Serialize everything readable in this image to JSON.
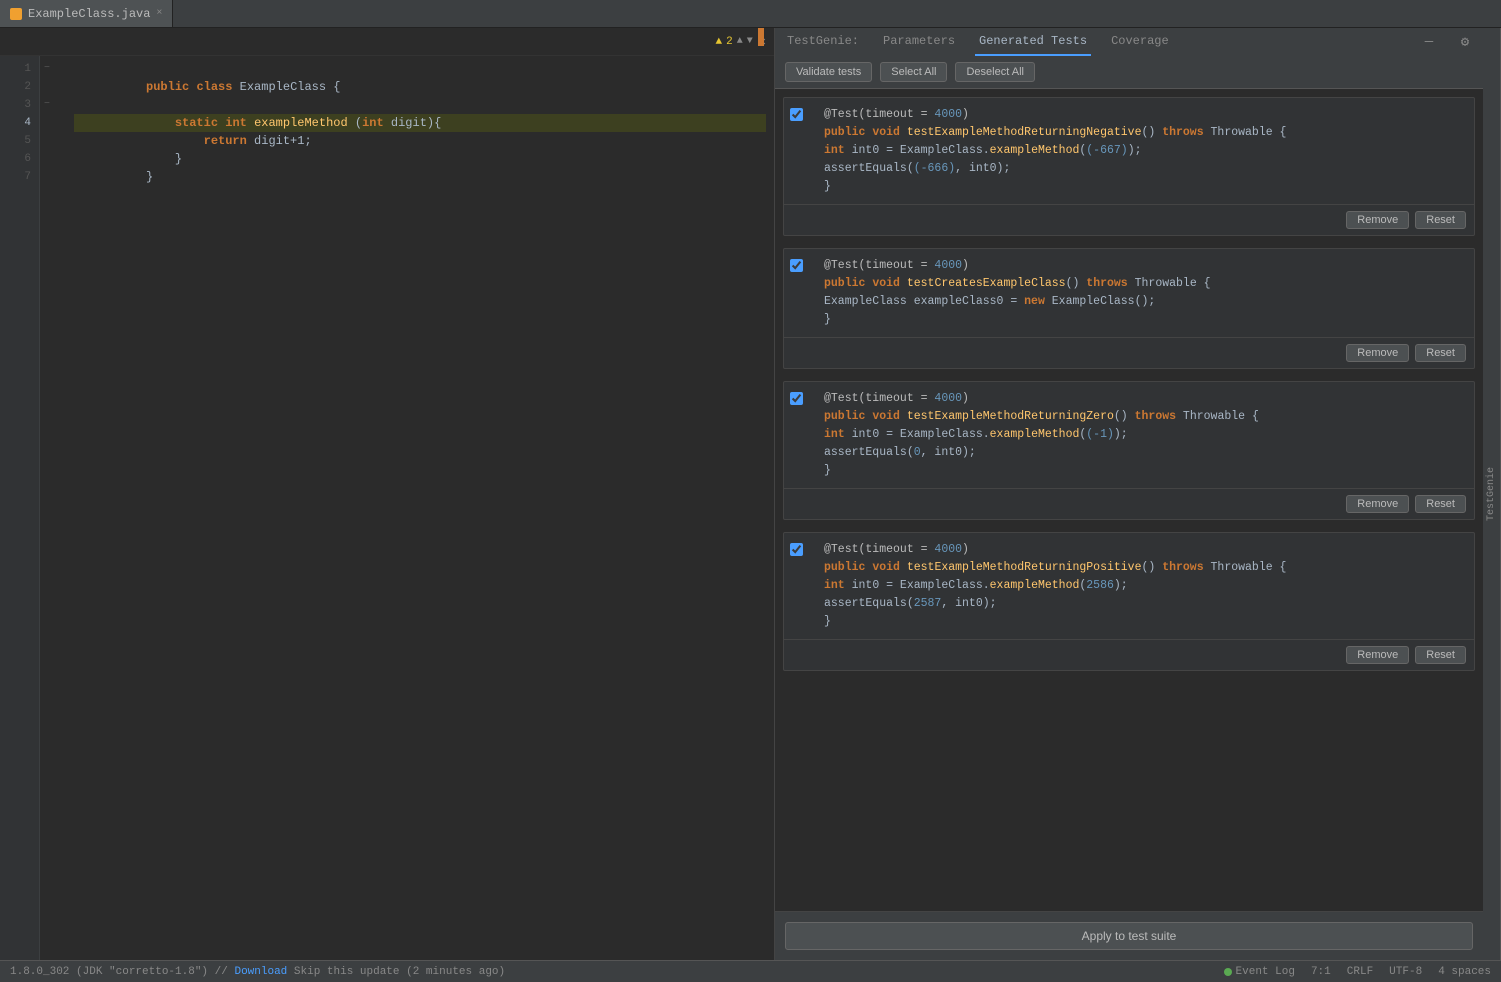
{
  "tabs": [
    {
      "id": "ExampleClass.java",
      "label": "ExampleClass.java",
      "icon": "java-icon"
    }
  ],
  "editor": {
    "lines": [
      {
        "num": 1,
        "content": "public class ExampleClass {",
        "tokens": [
          {
            "t": "kw",
            "v": "public"
          },
          {
            "t": "plain",
            "v": " "
          },
          {
            "t": "kw",
            "v": "class"
          },
          {
            "t": "plain",
            "v": " ExampleClass {"
          }
        ]
      },
      {
        "num": 2,
        "content": "",
        "tokens": []
      },
      {
        "num": 3,
        "content": "    static int exampleMethod (int digit){",
        "tokens": [
          {
            "t": "plain",
            "v": "    "
          },
          {
            "t": "kw",
            "v": "static"
          },
          {
            "t": "plain",
            "v": " "
          },
          {
            "t": "kw",
            "v": "int"
          },
          {
            "t": "plain",
            "v": " "
          },
          {
            "t": "method",
            "v": "exampleMethod"
          },
          {
            "t": "plain",
            "v": " ("
          },
          {
            "t": "kw",
            "v": "int"
          },
          {
            "t": "plain",
            "v": " digit){"
          }
        ]
      },
      {
        "num": 4,
        "content": "        return digit+1;",
        "tokens": [
          {
            "t": "plain",
            "v": "        "
          },
          {
            "t": "kw",
            "v": "return"
          },
          {
            "t": "plain",
            "v": " digit+1;"
          }
        ],
        "highlighted": true
      },
      {
        "num": 5,
        "content": "    }",
        "tokens": [
          {
            "t": "plain",
            "v": "    }"
          }
        ]
      },
      {
        "num": 6,
        "content": "}",
        "tokens": [
          {
            "t": "plain",
            "v": "}"
          }
        ]
      },
      {
        "num": 7,
        "content": "",
        "tokens": []
      }
    ],
    "warning_count": "▲ 2",
    "cursor_pos": "7:1",
    "line_sep": "CRLF",
    "encoding": "UTF-8",
    "indent": "4 spaces"
  },
  "panel": {
    "tabs": [
      {
        "id": "testgenie",
        "label": "TestGenie:"
      },
      {
        "id": "parameters",
        "label": "Parameters"
      },
      {
        "id": "generated_tests",
        "label": "Generated Tests"
      },
      {
        "id": "coverage",
        "label": "Coverage"
      }
    ],
    "active_tab": "generated_tests",
    "toolbar": {
      "validate_label": "Validate tests",
      "select_all_label": "Select All",
      "deselect_all_label": "Deselect All"
    },
    "tests": [
      {
        "id": "test1",
        "checked": true,
        "annotation": "@Test(timeout = 4000)",
        "annotation_timeout": "4000",
        "signature": "public void testExampleMethodReturningNegative() throws Throwable {",
        "body_lines": [
          "    int int0 = ExampleClass.exampleMethod((-667));",
          "    assertEquals((-666), int0);"
        ],
        "closing": "}",
        "method_name": "testExampleMethodReturningNegative",
        "remove_label": "Remove",
        "reset_label": "Reset"
      },
      {
        "id": "test2",
        "checked": true,
        "annotation": "@Test(timeout = 4000)",
        "annotation_timeout": "4000",
        "signature": "public void testCreatesExampleClass() throws Throwable {",
        "body_lines": [
          "    ExampleClass exampleClass0 = new ExampleClass();"
        ],
        "closing": "}",
        "method_name": "testCreatesExampleClass",
        "remove_label": "Remove",
        "reset_label": "Reset"
      },
      {
        "id": "test3",
        "checked": true,
        "annotation": "@Test(timeout = 4000)",
        "annotation_timeout": "4000",
        "signature": "public void testExampleMethodReturningZero() throws Throwable {",
        "body_lines": [
          "    int int0 = ExampleClass.exampleMethod((-1));",
          "    assertEquals(0, int0);"
        ],
        "closing": "}",
        "method_name": "testExampleMethodReturningZero",
        "remove_label": "Remove",
        "reset_label": "Reset"
      },
      {
        "id": "test4",
        "checked": true,
        "annotation": "@Test(timeout = 4000)",
        "annotation_timeout": "4000",
        "signature": "public void testExampleMethodReturningPositive() throws Throwable {",
        "body_lines": [
          "    int int0 = ExampleClass.exampleMethod(2586);",
          "    assertEquals(2587, int0);"
        ],
        "closing": "}",
        "method_name": "testExampleMethodReturningPositive",
        "remove_label": "Remove",
        "reset_label": "Reset"
      }
    ],
    "apply_label": "Apply to test suite",
    "side_label": "TestGenie"
  },
  "status_bar": {
    "java_version": "1.8.0_302 (JDK \"corretto-1.8\")",
    "download_label": "Download",
    "skip_update": "Skip this update (2 minutes ago)",
    "event_log_label": "Event Log",
    "cursor": "7:1",
    "line_sep": "CRLF",
    "encoding": "UTF-8",
    "indent": "4 spaces"
  },
  "settings_icon": "⚙",
  "minimize_icon": "—"
}
